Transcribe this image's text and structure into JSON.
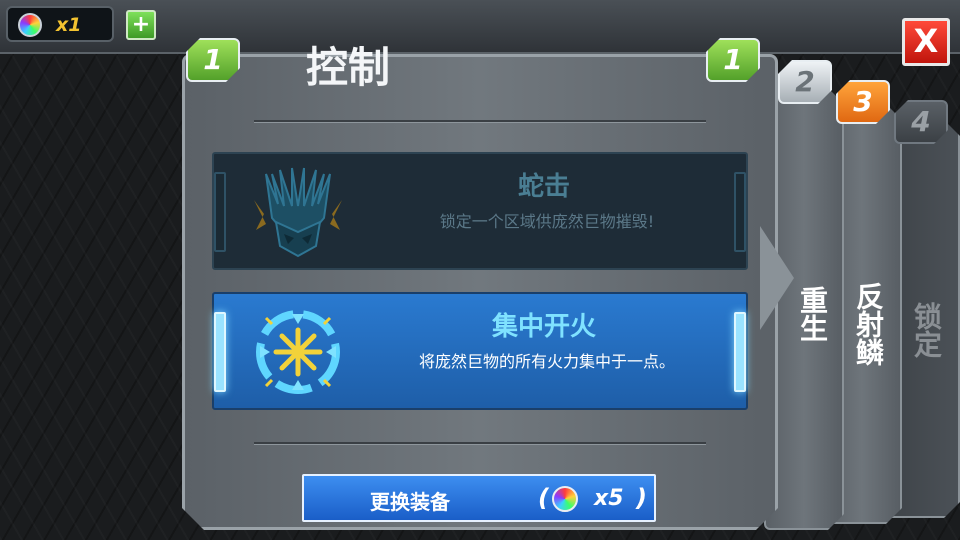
{
  "header": {
    "currency_count": "x1",
    "add_label": "+",
    "close_label": "X"
  },
  "panel": {
    "title": "控制",
    "tab_left": "1",
    "tab_right": "1"
  },
  "side_cards": [
    {
      "tab": "2",
      "label": "重生"
    },
    {
      "tab": "3",
      "label": "反射鳞"
    },
    {
      "tab": "4",
      "label": "锁定"
    }
  ],
  "abilities": [
    {
      "name": "蛇击",
      "description": "锁定一个区域供庞然巨物摧毁!",
      "state": "dimmed"
    },
    {
      "name": "集中开火",
      "description": "将庞然巨物的所有火力集中于一点。",
      "state": "selected"
    }
  ],
  "swap_button": {
    "label": "更换装备",
    "open_paren": "(",
    "close_paren": ")",
    "cost": "x5"
  },
  "icons": {
    "currency": "rainbow-gem-icon",
    "ability_1": "serpent-strike-icon",
    "ability_2": "focus-fire-icon"
  },
  "colors": {
    "selected_blue": "#1e5ea8",
    "tab_green": "#53a12a",
    "tab_orange": "#e06812",
    "close_red": "#c0150c",
    "currency_gold": "#f2c230"
  }
}
